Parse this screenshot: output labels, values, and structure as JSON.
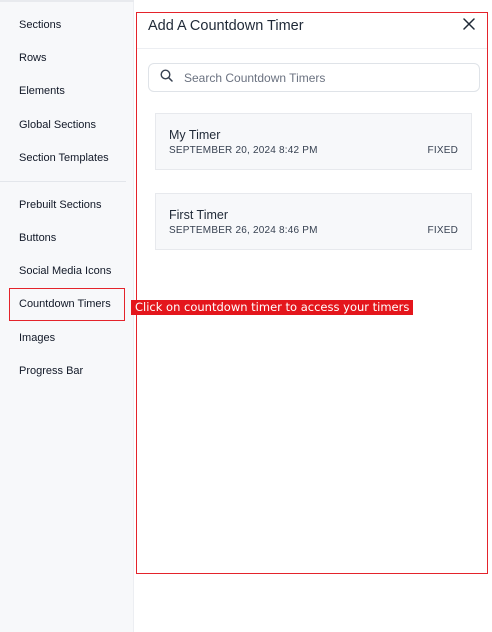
{
  "sidebar": {
    "items": [
      {
        "label": "Sections",
        "name": "sidebar-item-sections"
      },
      {
        "label": "Rows",
        "name": "sidebar-item-rows"
      },
      {
        "label": "Elements",
        "name": "sidebar-item-elements"
      },
      {
        "label": "Global Sections",
        "name": "sidebar-item-global-sections"
      },
      {
        "label": "Section Templates",
        "name": "sidebar-item-section-templates"
      },
      {
        "label": "Prebuilt Sections",
        "name": "sidebar-item-prebuilt-sections"
      },
      {
        "label": "Buttons",
        "name": "sidebar-item-buttons"
      },
      {
        "label": "Social Media Icons",
        "name": "sidebar-item-social-media-icons"
      },
      {
        "label": "Countdown Timers",
        "name": "sidebar-item-countdown-timers"
      },
      {
        "label": "Images",
        "name": "sidebar-item-images"
      },
      {
        "label": "Progress Bar",
        "name": "sidebar-item-progress-bar"
      }
    ]
  },
  "annotation": {
    "text": "Click on countdown timer to access your timers",
    "color": "#e4161c"
  },
  "panel": {
    "title": "Add A Countdown Timer",
    "close_icon": "close-icon",
    "search": {
      "placeholder": "Search Countdown Timers",
      "icon": "search-icon"
    },
    "timers": [
      {
        "name": "My Timer",
        "date": "SEPTEMBER 20, 2024 8:42 PM",
        "type": "FIXED"
      },
      {
        "name": "First Timer",
        "date": "SEPTEMBER 26, 2024 8:46 PM",
        "type": "FIXED"
      }
    ]
  },
  "colors": {
    "highlight": "#e4232b",
    "sidebar_bg": "#f7f8fa",
    "card_bg": "#f7f8fa"
  }
}
